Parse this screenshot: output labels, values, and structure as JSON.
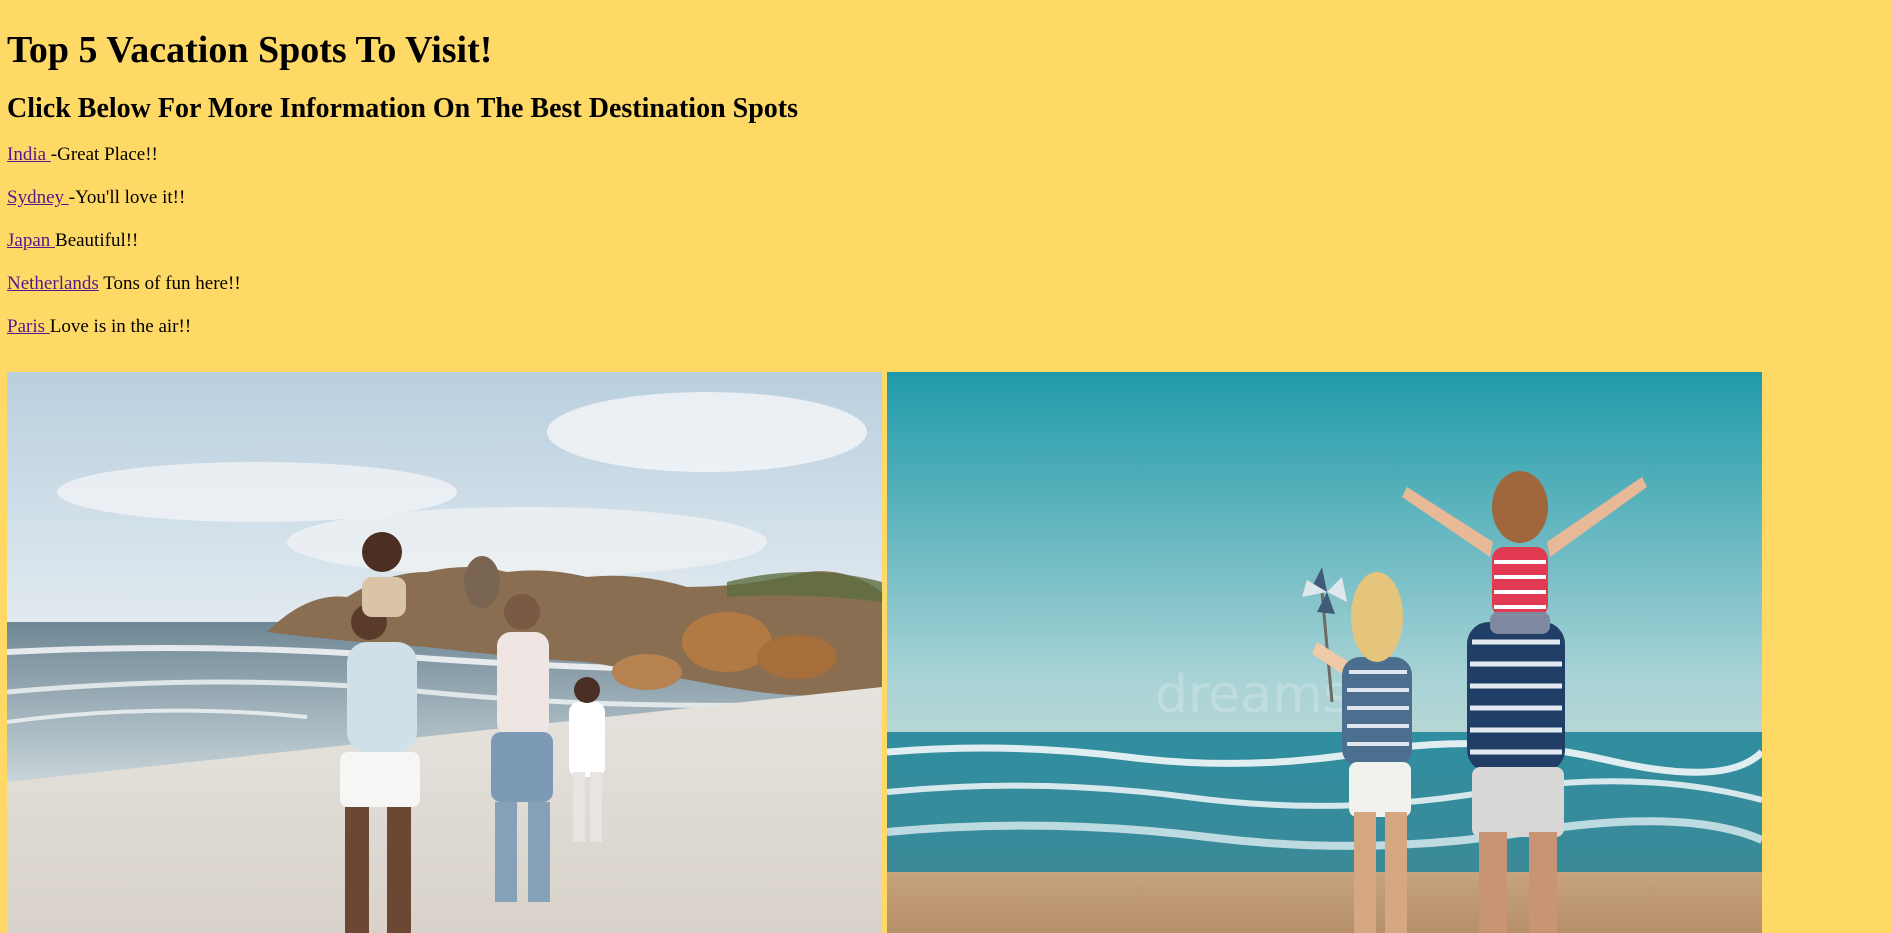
{
  "page": {
    "title": "Top 5 Vacation Spots To Visit!",
    "subtitle": "Click Below For More Information On The Best Destination Spots"
  },
  "destinations": [
    {
      "link": "India ",
      "text": "-Great Place!!"
    },
    {
      "link": "Sydney ",
      "text": "-You'll love it!!"
    },
    {
      "link": "Japan ",
      "text": "Beautiful!!"
    },
    {
      "link": "Netherlands",
      "text": " Tons of fun here!!"
    },
    {
      "link": "Paris ",
      "text": "Love is in the air!!"
    }
  ],
  "colors": {
    "background": "#FFD966",
    "link": "#551A8B"
  },
  "images": [
    {
      "name": "family-beach-photo-1"
    },
    {
      "name": "family-beach-photo-2"
    }
  ]
}
